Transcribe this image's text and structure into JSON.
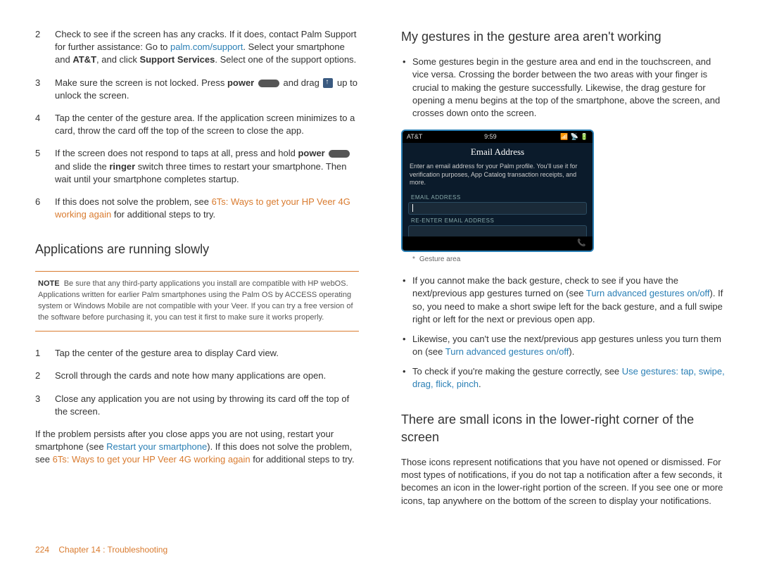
{
  "left": {
    "steps_a": [
      {
        "n": "2",
        "pre": "Check to see if the screen has any cracks. If it does, contact Palm Support for further assistance: Go to ",
        "link": "palm.com/support",
        "mid": ". Select your smartphone and ",
        "b1": "AT&T",
        "mid2": ", and click ",
        "b2": "Support Services",
        "post": ". Select one of the support options."
      },
      {
        "n": "3",
        "pre": "Make sure the screen is not locked. Press ",
        "b1": "power",
        "mid": " ",
        "icon1": "power",
        "mid2": " and drag ",
        "icon2": "drag",
        "post": " up to unlock the screen."
      },
      {
        "n": "4",
        "text": "Tap the center of the gesture area. If the application screen minimizes to a card, throw the card off the top of the screen to close the app."
      },
      {
        "n": "5",
        "pre": "If the screen does not respond to taps at all, press and hold ",
        "b1": "power",
        "mid": " ",
        "icon1": "power",
        "mid2": " and slide the ",
        "b2": "ringer",
        "post": " switch three times to restart your smartphone. Then wait until your smartphone completes startup."
      },
      {
        "n": "6",
        "pre": "If this does not solve the problem, see ",
        "olink": "6Ts: Ways to get your HP Veer 4G working again",
        "post": " for additional steps to try."
      }
    ],
    "h2a": "Applications are running slowly",
    "note_label": "NOTE",
    "note": "Be sure that any third-party applications you install are compatible with HP webOS. Applications written for earlier Palm smartphones using the Palm OS by ACCESS operating system or Windows Mobile are not compatible with your Veer. If you can try a free version of the software before purchasing it, you can test it first to make sure it works properly.",
    "steps_b": [
      {
        "n": "1",
        "text": "Tap the center of the gesture area to display Card view."
      },
      {
        "n": "2",
        "text": "Scroll through the cards and note how many applications are open."
      },
      {
        "n": "3",
        "text": "Close any application you are not using by throwing its card off the top of the screen."
      }
    ],
    "persist_pre": "If the problem persists after you close apps you are not using, restart your smartphone (see ",
    "persist_link1": "Restart your smartphone",
    "persist_mid": "). If this does not solve the problem, see ",
    "persist_link2": "6Ts: Ways to get your HP Veer 4G working again",
    "persist_post": " for additional steps to try."
  },
  "right": {
    "h2a": "My gestures in the gesture area aren't working",
    "bullet1": "Some gestures begin in the gesture area and end in the touchscreen, and vice versa. Crossing the border between the two areas with your finger is crucial to making the gesture successfully. Likewise, the drag gesture for opening a menu begins at the top of the smartphone, above the screen, and crosses down onto the screen.",
    "phone": {
      "carrier": "AT&T",
      "time": "9:59",
      "title": "Email Address",
      "desc": "Enter an email address for your Palm profile. You'll use it for verification purposes, App Catalog transaction receipts, and more.",
      "f1": "EMAIL ADDRESS",
      "f2": "RE-ENTER EMAIL ADDRESS"
    },
    "caption_ast": "*",
    "caption": "Gesture area",
    "bullet2_pre": "If you cannot make the back gesture, check to see if you have the next/previous app gestures turned on (see ",
    "bullet2_link": "Turn advanced gestures on/off",
    "bullet2_post": "). If so, you need to make a short swipe left for the back gesture, and a full swipe right or left for the next or previous open app.",
    "bullet3_pre": "Likewise, you can't use the next/previous app gestures unless you turn them on (see ",
    "bullet3_link": "Turn advanced gestures on/off",
    "bullet3_post": ").",
    "bullet4_pre": "To check if you're making the gesture correctly, see ",
    "bullet4_link": "Use gestures: tap, swipe, drag, flick, pinch",
    "bullet4_post": ".",
    "h2b": "There are small icons in the lower-right corner of the screen",
    "para": "Those icons represent notifications that you have not opened or dismissed. For most types of notifications, if you do not tap a notification after a few seconds, it becomes an icon in the lower-right portion of the screen. If you see one or more icons, tap anywhere on the bottom of the screen to display your notifications."
  },
  "footer": {
    "page": "224",
    "chapter": "Chapter 14 : Troubleshooting"
  }
}
